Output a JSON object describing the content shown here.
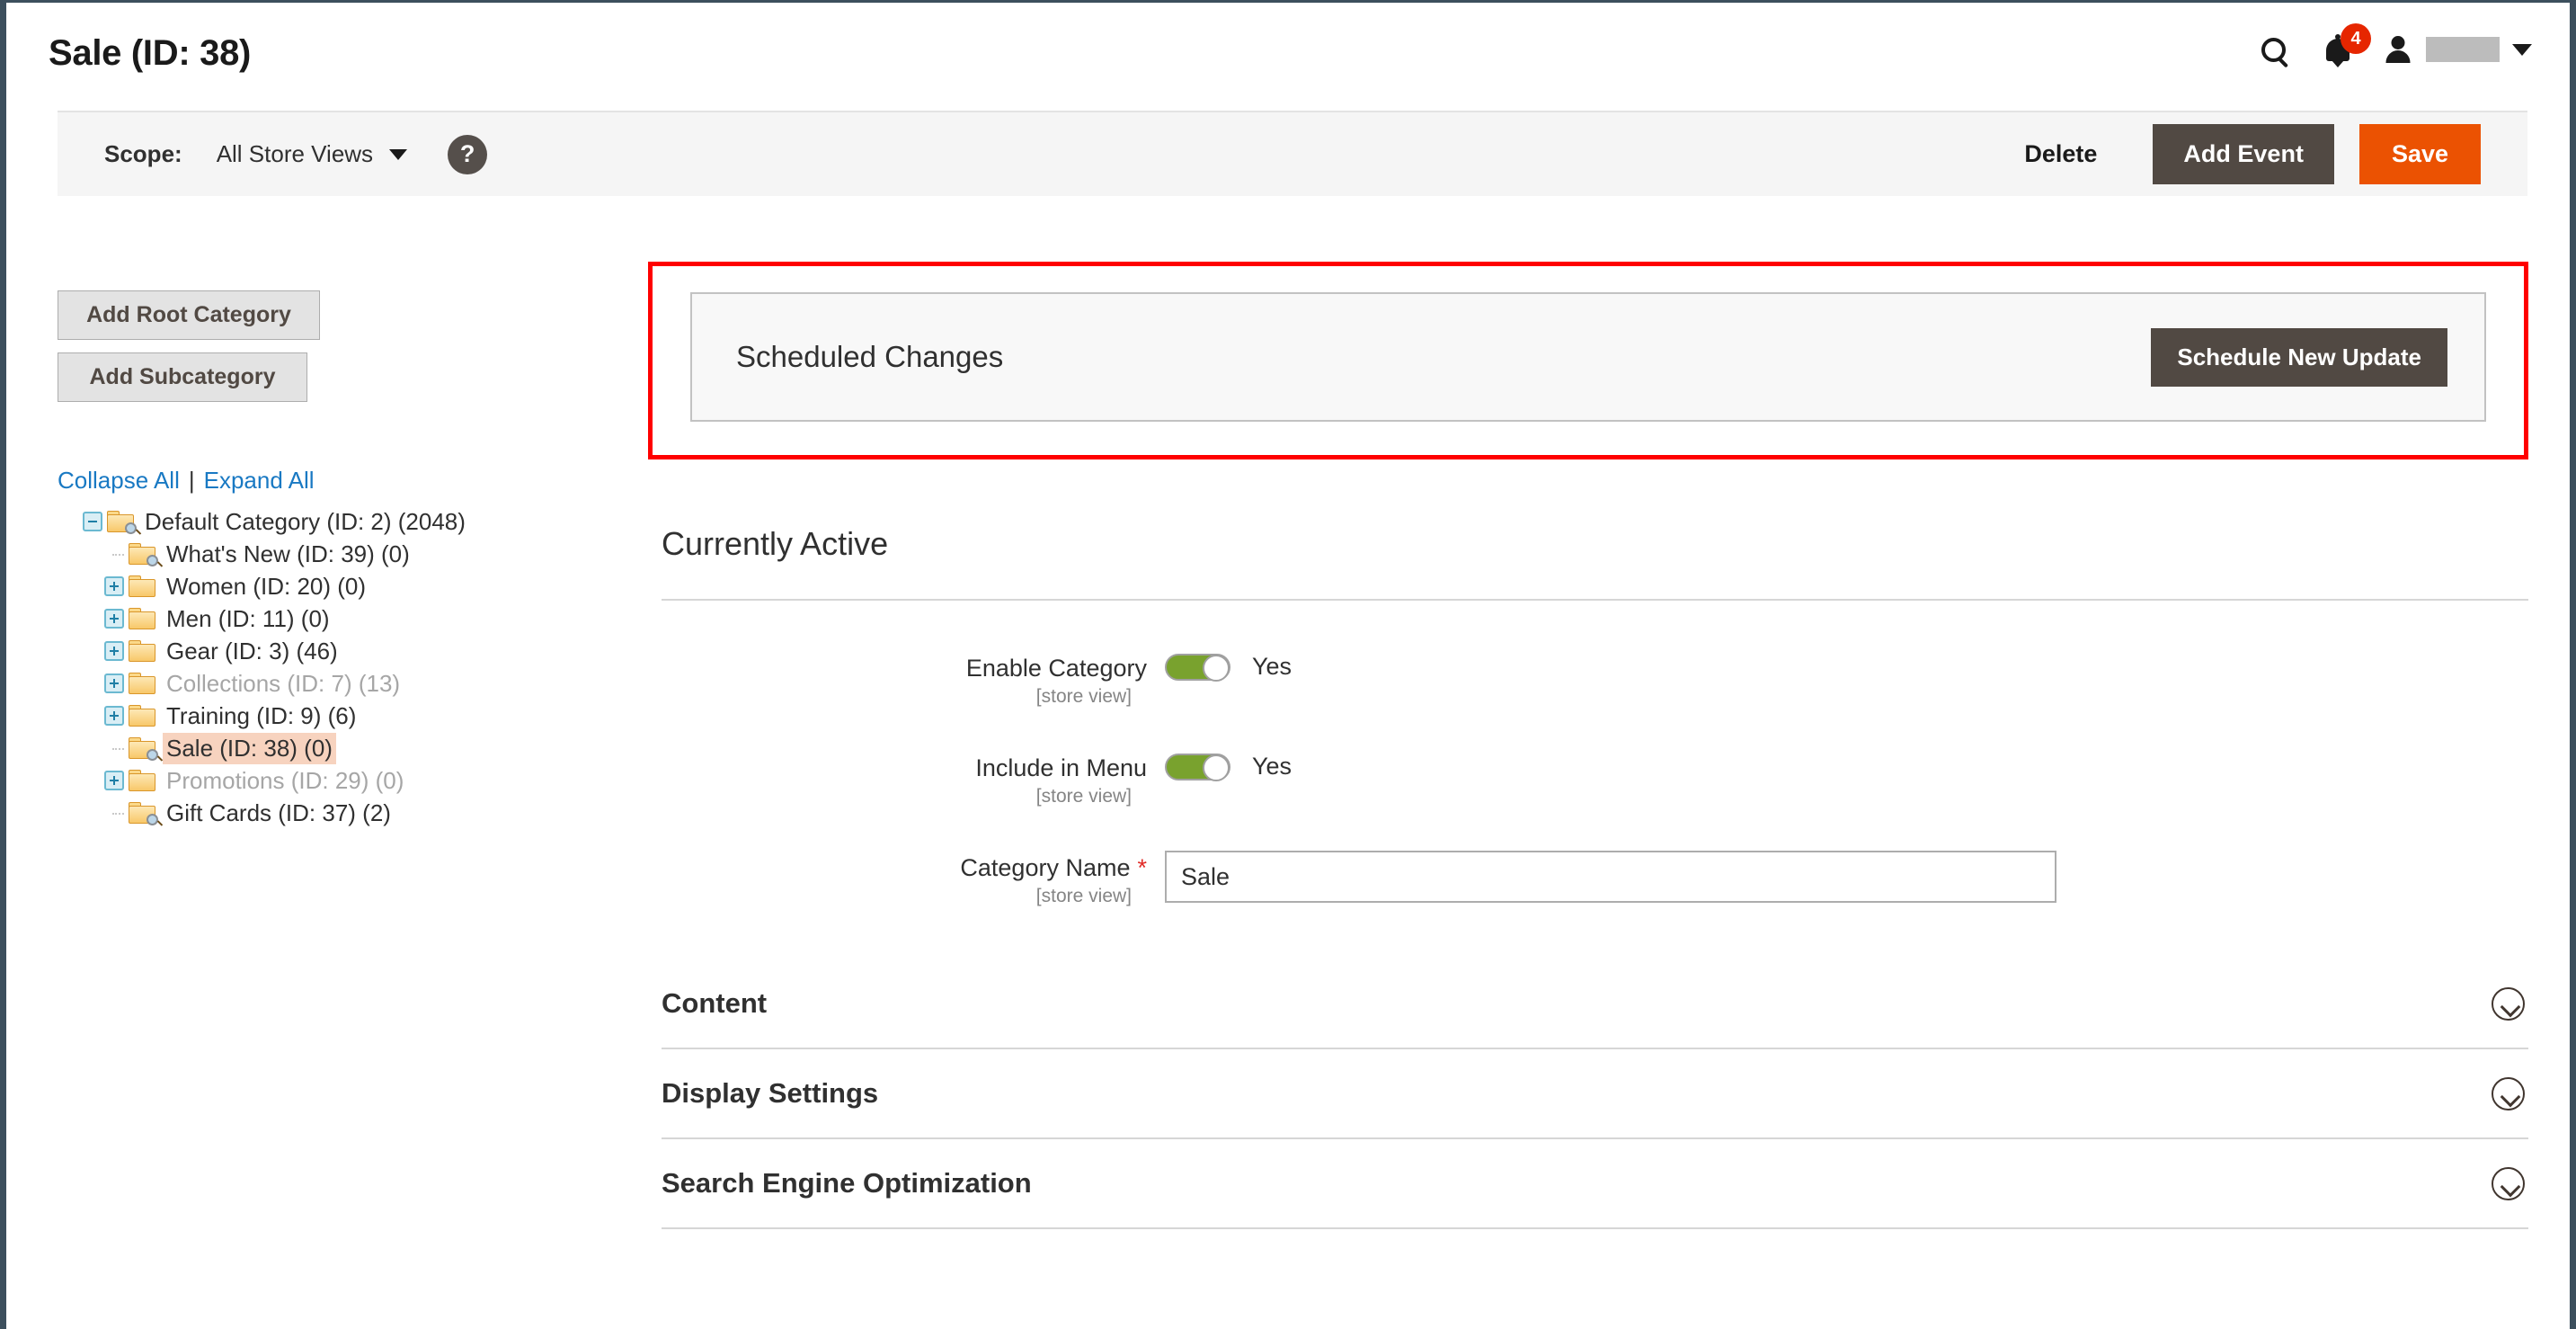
{
  "header": {
    "page_title": "Sale (ID: 38)",
    "search_icon": "search-icon",
    "notifications_icon": "bell-icon",
    "notifications_count": "4",
    "user_icon": "user-icon",
    "user_name": "",
    "user_caret": "chevron-down-icon"
  },
  "scope_bar": {
    "scope_label": "Scope:",
    "scope_value": "All Store Views",
    "scope_caret_icon": "chevron-down-icon",
    "help_icon": "question-mark-icon",
    "help_glyph": "?",
    "delete_label": "Delete",
    "add_event_label": "Add Event",
    "save_label": "Save"
  },
  "sidebar": {
    "add_root_category_label": "Add Root Category",
    "add_subcategory_label": "Add Subcategory",
    "collapse_all_label": "Collapse All",
    "expand_all_label": "Expand All",
    "separator": "|",
    "tree": [
      {
        "label": "Default Category (ID: 2) (2048)",
        "level": 0,
        "state": "expanded",
        "toggle": "minus",
        "icon": "folder-search-icon",
        "dim": false,
        "selected": false
      },
      {
        "label": "What's New (ID: 39) (0)",
        "level": 1,
        "state": "leaf",
        "toggle": "none",
        "icon": "folder-search-icon",
        "dim": false,
        "selected": false
      },
      {
        "label": "Women (ID: 20) (0)",
        "level": 1,
        "state": "collapsed",
        "toggle": "plus",
        "icon": "folder-icon",
        "dim": false,
        "selected": false
      },
      {
        "label": "Men (ID: 11) (0)",
        "level": 1,
        "state": "collapsed",
        "toggle": "plus",
        "icon": "folder-icon",
        "dim": false,
        "selected": false
      },
      {
        "label": "Gear (ID: 3) (46)",
        "level": 1,
        "state": "collapsed",
        "toggle": "plus",
        "icon": "folder-icon",
        "dim": false,
        "selected": false
      },
      {
        "label": "Collections (ID: 7) (13)",
        "level": 1,
        "state": "collapsed",
        "toggle": "plus",
        "icon": "folder-icon",
        "dim": true,
        "selected": false
      },
      {
        "label": "Training (ID: 9) (6)",
        "level": 1,
        "state": "collapsed",
        "toggle": "plus",
        "icon": "folder-icon",
        "dim": false,
        "selected": false
      },
      {
        "label": "Sale (ID: 38) (0)",
        "level": 1,
        "state": "leaf",
        "toggle": "none",
        "icon": "folder-search-icon",
        "dim": false,
        "selected": true
      },
      {
        "label": "Promotions (ID: 29) (0)",
        "level": 1,
        "state": "collapsed",
        "toggle": "plus",
        "icon": "folder-icon",
        "dim": true,
        "selected": false
      },
      {
        "label": "Gift Cards (ID: 37) (2)",
        "level": 1,
        "state": "leaf",
        "toggle": "none",
        "icon": "folder-search-icon",
        "dim": false,
        "selected": false
      }
    ]
  },
  "main": {
    "scheduled_changes_title": "Scheduled Changes",
    "schedule_new_update_label": "Schedule New Update",
    "currently_active_heading": "Currently Active",
    "fields": [
      {
        "label": "Enable Category",
        "scope_note": "[store view]",
        "type": "toggle",
        "value": "Yes",
        "required": false
      },
      {
        "label": "Include in Menu",
        "scope_note": "[store view]",
        "type": "toggle",
        "value": "Yes",
        "required": false
      },
      {
        "label": "Category Name",
        "scope_note": "[store view]",
        "type": "text",
        "value": "Sale",
        "required": true,
        "required_marker": "*"
      }
    ],
    "collapsibles": [
      {
        "title": "Content",
        "icon": "chevron-down-circle-icon"
      },
      {
        "title": "Display Settings",
        "icon": "chevron-down-circle-icon"
      },
      {
        "title": "Search Engine Optimization",
        "icon": "chevron-down-circle-icon"
      }
    ]
  },
  "colors": {
    "accent_orange": "#eb5202",
    "dark_button": "#514943",
    "toggle_green": "#79a22e",
    "link_blue": "#1979c3",
    "badge_red": "#e62600",
    "selected_row": "#f7d3bf",
    "annotation_red": "#ff0000",
    "required_red": "#e02b27"
  }
}
